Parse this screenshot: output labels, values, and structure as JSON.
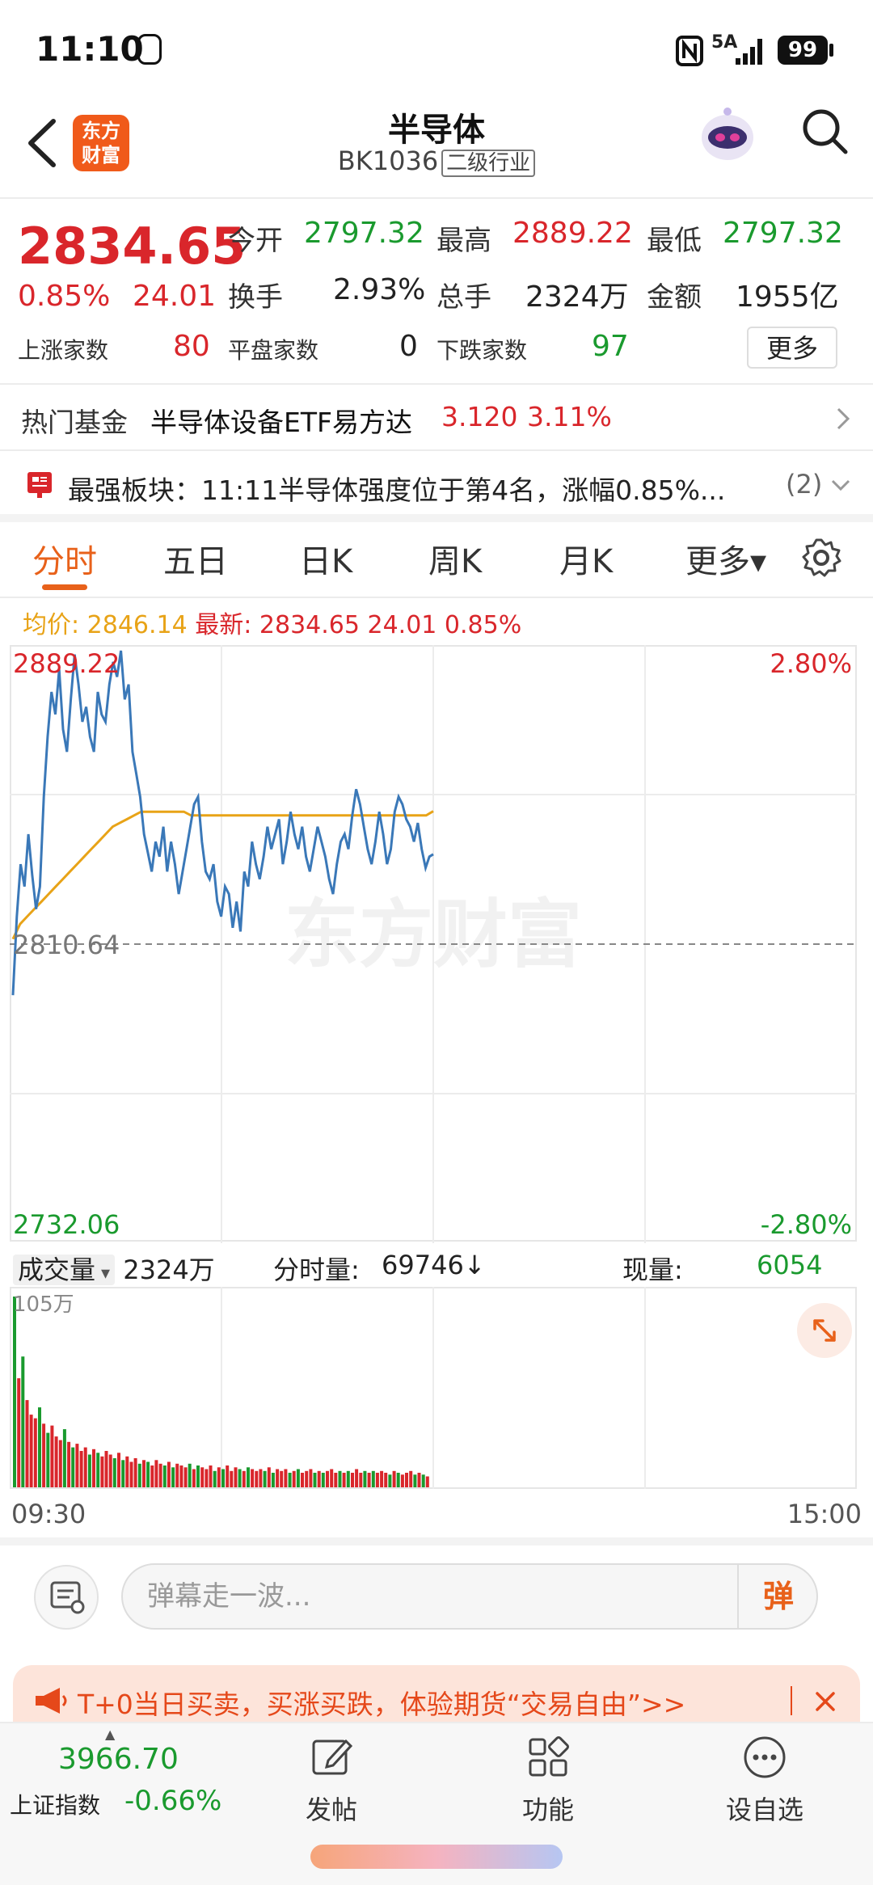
{
  "status_bar": {
    "time": "11:10",
    "network": "5A",
    "battery": "99"
  },
  "header": {
    "title": "半导体",
    "code": "BK1036",
    "tag": "二级行业",
    "logo_text": [
      "东方",
      "财富"
    ]
  },
  "quote": {
    "price": "2834.65",
    "change_pct": "0.85%",
    "change": "24.01",
    "open_label": "今开",
    "open": "2797.32",
    "high_label": "最高",
    "high": "2889.22",
    "low_label": "最低",
    "low": "2797.32",
    "turnover_label": "换手",
    "turnover": "2.93%",
    "volume_label": "总手",
    "volume": "2324万",
    "amount_label": "金额",
    "amount": "1955亿",
    "up_label": "上涨家数",
    "up": "80",
    "flat_label": "平盘家数",
    "flat": "0",
    "down_label": "下跌家数",
    "down": "97",
    "more_label": "更多"
  },
  "hot_fund": {
    "label": "热门基金",
    "name": "半导体设备ETF易方达",
    "price": "3.120",
    "pct": "3.11%"
  },
  "news": {
    "text": "最强板块：11:11半导体强度位于第4名，涨幅0.85%...",
    "count": "(2)"
  },
  "tabs": [
    "分时",
    "五日",
    "日K",
    "周K",
    "月K",
    "更多▾"
  ],
  "legend": {
    "avg_label": "均价: 2846.14",
    "latest_label": "最新: 2834.65 24.01 0.85%"
  },
  "chart_data": {
    "type": "line",
    "y_max_label": "2889.22",
    "y_min_label": "2732.06",
    "y_mid_label": "2810.64",
    "pct_max_label": "2.80%",
    "pct_min_label": "-2.80%",
    "ylim": [
      2732.06,
      2889.22
    ],
    "prev_close": 2810.64,
    "x_start": "09:30",
    "x_end": "15:00",
    "total_minutes": 240,
    "series": [
      {
        "values": [
          2797,
          2818,
          2832,
          2826,
          2840,
          2829,
          2820,
          2826,
          2850,
          2866,
          2878,
          2872,
          2884,
          2868,
          2862,
          2876,
          2888,
          2880,
          2870,
          2874,
          2866,
          2862,
          2878,
          2872,
          2870,
          2880,
          2886,
          2882,
          2889,
          2876,
          2880,
          2862,
          2856,
          2850,
          2840,
          2835,
          2830,
          2838,
          2834,
          2842,
          2830,
          2838,
          2832,
          2824,
          2830,
          2836,
          2842,
          2848,
          2850,
          2838,
          2830,
          2828,
          2832,
          2822,
          2818,
          2826,
          2824,
          2815,
          2822,
          2814,
          2830,
          2826,
          2838,
          2832,
          2828,
          2834,
          2842,
          2836,
          2840,
          2844,
          2832,
          2838,
          2846,
          2840,
          2836,
          2842,
          2834,
          2830,
          2836,
          2842,
          2838,
          2834,
          2828,
          2824,
          2832,
          2838,
          2840,
          2836,
          2845,
          2852,
          2848,
          2842,
          2836,
          2832,
          2838,
          2846,
          2840,
          2832,
          2836,
          2846,
          2850,
          2848,
          2844,
          2842,
          2838,
          2843,
          2836,
          2831,
          2834,
          2834.65
        ]
      },
      {
        "values": [
          2812,
          2816,
          2818,
          2820,
          2822,
          2824,
          2826,
          2828,
          2830,
          2832,
          2834,
          2836,
          2838,
          2840,
          2842,
          2843,
          2844,
          2845,
          2846,
          2846,
          2846,
          2846,
          2846,
          2846,
          2846,
          2845,
          2845,
          2845,
          2845,
          2845,
          2845,
          2845,
          2845,
          2845,
          2845,
          2845,
          2845,
          2845,
          2845,
          2845,
          2845,
          2845,
          2845,
          2845,
          2845,
          2845,
          2845,
          2845,
          2845,
          2845,
          2845,
          2845,
          2845,
          2845,
          2845,
          2845,
          2845,
          2845,
          2845,
          2846.14
        ]
      }
    ],
    "volume": {
      "label": "成交量",
      "total": "2324万",
      "minute_label": "分时量:",
      "minute_value": "69746↓",
      "current_label": "现量:",
      "current_value": "6054",
      "max_label": "105万",
      "values": [
        105,
        60,
        72,
        48,
        40,
        38,
        44,
        35,
        30,
        34,
        28,
        26,
        32,
        25,
        22,
        24,
        20,
        22,
        18,
        21,
        19,
        17,
        20,
        18,
        16,
        19,
        15,
        17,
        14,
        16,
        13,
        15,
        14,
        12,
        15,
        13,
        12,
        14,
        11,
        13,
        12,
        11,
        13,
        10,
        12,
        11,
        10,
        12,
        9,
        11,
        10,
        12,
        9,
        11,
        10,
        9,
        11,
        10,
        9,
        10,
        9,
        11,
        8,
        10,
        9,
        10,
        8,
        9,
        10,
        8,
        9,
        10,
        8,
        9,
        8,
        9,
        10,
        8,
        9,
        8,
        9,
        8,
        10,
        8,
        9,
        8,
        9,
        8,
        9,
        8,
        7,
        9,
        8,
        7,
        8,
        9,
        7,
        8,
        7,
        6
      ]
    }
  },
  "danmu": {
    "placeholder": "弹幕走一波...",
    "button": "弹"
  },
  "promo": {
    "text": "T+0当日买卖，买涨买跌，体验期货“交易自由”>>"
  },
  "bottom_nav": {
    "index_value": "3966.70",
    "index_name": "上证指数",
    "index_pct": "-0.66%",
    "items": [
      "发帖",
      "功能",
      "设自选"
    ]
  }
}
